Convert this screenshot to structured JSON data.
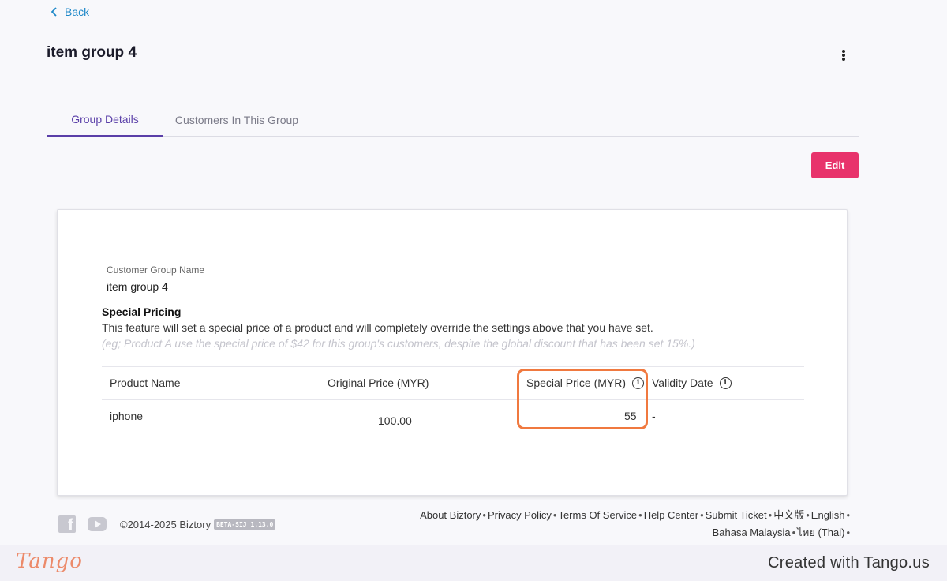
{
  "header": {
    "back_label": "Back",
    "title": "item group 4"
  },
  "tabs": [
    {
      "label": "Group Details",
      "active": true
    },
    {
      "label": "Customers In This Group",
      "active": false
    }
  ],
  "edit_label": "Edit",
  "details": {
    "group_name_label": "Customer Group Name",
    "group_name_value": "item group 4",
    "special_pricing_title": "Special Pricing",
    "special_pricing_desc": "This feature will set a special price of a product and will completely override the settings above that you have set.",
    "special_pricing_example": "(eg; Product A use the special price of $42 for this group's customers, despite the global discount that has been set 15%.)"
  },
  "table": {
    "headers": {
      "product_name": "Product Name",
      "original_price": "Original Price (MYR)",
      "special_price": "Special Price (MYR)",
      "validity_date": "Validity Date"
    },
    "rows": [
      {
        "product_name": "iphone",
        "original_price": "100.00",
        "special_price": "55",
        "validity_date": "-"
      }
    ]
  },
  "footer": {
    "copyright": "©2014-2025 Biztory",
    "version_badge": "BETA-SIJ 1.13.0",
    "links": [
      "About Biztory",
      "Privacy Policy",
      "Terms Of Service",
      "Help Center",
      "Submit Ticket",
      "中文版",
      "English",
      "Bahasa Malaysia",
      "ไทย (Thai)"
    ]
  },
  "overlay": {
    "tango_logo": "Tango",
    "tango_created": "Created with Tango.us"
  },
  "colors": {
    "accent": "#5a3fa8",
    "edit_button": "#e8336b",
    "highlight": "#f0793f",
    "back_link": "#1e88c8"
  },
  "icons": [
    "chevron-left-icon",
    "kebab-menu-icon",
    "info-icon",
    "facebook-icon",
    "youtube-icon"
  ]
}
